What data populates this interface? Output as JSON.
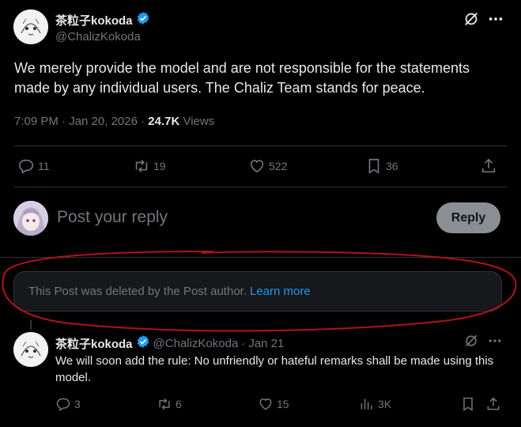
{
  "main_post": {
    "display_name": "茶粒子kokoda",
    "handle": "@ChalizKokoda",
    "text": "We merely provide the model and are not responsible for the statements made by any individual users. The Chaliz Team stands for peace.",
    "time": "7:09 PM · Jan 20, 2026 · ",
    "views_count": "24.7K",
    "views_label": "Views",
    "stats": {
      "replies": "11",
      "reposts": "19",
      "likes": "522",
      "bookmarks": "36"
    }
  },
  "composer": {
    "placeholder": "Post your reply",
    "reply_button": "Reply"
  },
  "deleted_notice": {
    "text": "This Post was deleted by the Post author.",
    "link": "Learn more"
  },
  "reply_post": {
    "display_name": "茶粒子kokoda",
    "handle": "@ChalizKokoda",
    "separator": "·",
    "date": "Jan 21",
    "text": "We will soon add the rule: No unfriendly or hateful remarks shall be made using this model.",
    "stats": {
      "replies": "3",
      "reposts": "6",
      "likes": "15",
      "views": "3K"
    }
  },
  "colors": {
    "background": "#000000",
    "text": "#e7e9ea",
    "muted": "#71767b",
    "accent": "#1d9bf0",
    "annotation": "#b0131c"
  },
  "icons": [
    "verified-badge-icon",
    "grok-icon",
    "more-icon",
    "reply-icon",
    "repost-icon",
    "like-icon",
    "bookmark-icon",
    "share-icon",
    "views-icon"
  ]
}
